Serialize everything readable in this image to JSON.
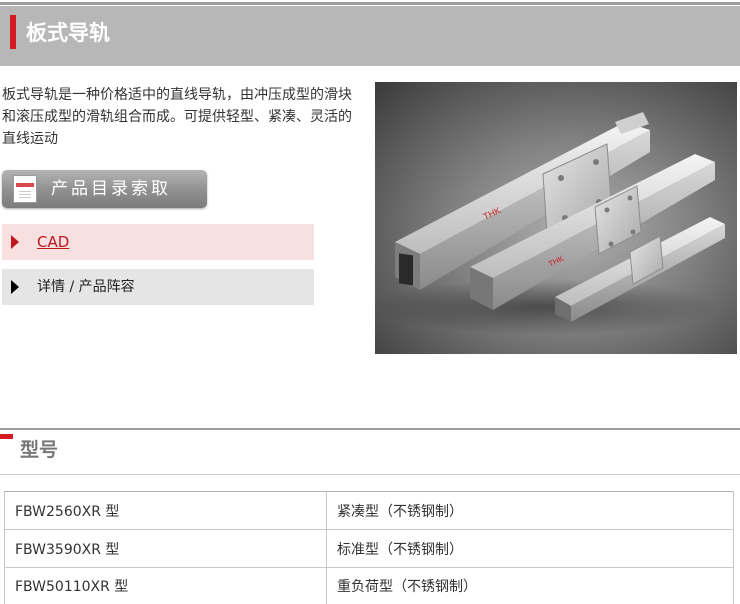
{
  "header": {
    "title": "板式导轨"
  },
  "intro": {
    "text": "板式导轨是一种价格适中的直线导轨，由冲压成型的滑块和滚压成型的滑轨组合而成。可提供轻型、紧凑、灵活的直线运动"
  },
  "catalog_button": {
    "label": "产品目录索取"
  },
  "nav": {
    "cad": "CAD",
    "detail": "详情 / 产品阵容"
  },
  "models_section": {
    "title": "型号"
  },
  "models": [
    {
      "name": "FBW2560XR 型",
      "desc": "紧凑型（不锈钢制）"
    },
    {
      "name": "FBW3590XR 型",
      "desc": "标准型（不锈钢制）"
    },
    {
      "name": "FBW50110XR 型",
      "desc": "重负荷型（不锈钢制）"
    }
  ],
  "colors": {
    "accent": "#d31d22",
    "header_bg": "#b7b7b7",
    "cad_bg": "#f9e0e0",
    "cad_text": "#c0171e"
  }
}
